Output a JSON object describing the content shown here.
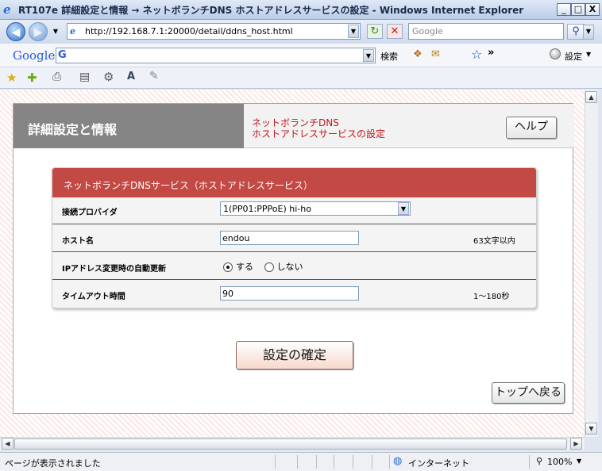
{
  "window": {
    "title": "RT107e 詳細設定と情報 → ネットボランチDNS ホストアドレスサービスの設定 - Windows Internet Explorer",
    "minimize": "_",
    "maximize": "□",
    "close": "X"
  },
  "nav": {
    "back_icon": "arrow-left-icon",
    "forward_icon": "arrow-right-icon",
    "url": "http://192.168.7.1:20000/detail/ddns_host.html",
    "search_placeholder": "Google"
  },
  "google_toolbar": {
    "logo": "Google",
    "search_label": "検索",
    "settings_label": "設定"
  },
  "page": {
    "header_title": "詳細設定と情報",
    "subtitle_line1": "ネットボランチDNS",
    "subtitle_line2": "ホストアドレスサービスの設定",
    "help_button": "ヘルプ",
    "box_title": "ネットボランチDNSサービス（ホストアドレスサービス）",
    "rows": [
      {
        "label": "接続プロバイダ",
        "value": "1(PP01:PPPoE) hi-ho",
        "note": ""
      },
      {
        "label": "ホスト名",
        "value": "endou",
        "note": "63文字以内"
      },
      {
        "label": "IPアドレス変更時の自動更新",
        "option_yes": "する",
        "option_no": "しない",
        "selected": "する"
      },
      {
        "label": "タイムアウト時間",
        "value": "90",
        "note": "1〜180秒"
      }
    ],
    "confirm_button": "設定の確定",
    "top_button": "トップへ戻る"
  },
  "status": {
    "text": "ページが表示されました",
    "zone": "インターネット",
    "zoom": "100%"
  },
  "colors": {
    "accent_red": "#c34945",
    "header_gray": "#858585",
    "subtitle_red": "#c0161c"
  }
}
